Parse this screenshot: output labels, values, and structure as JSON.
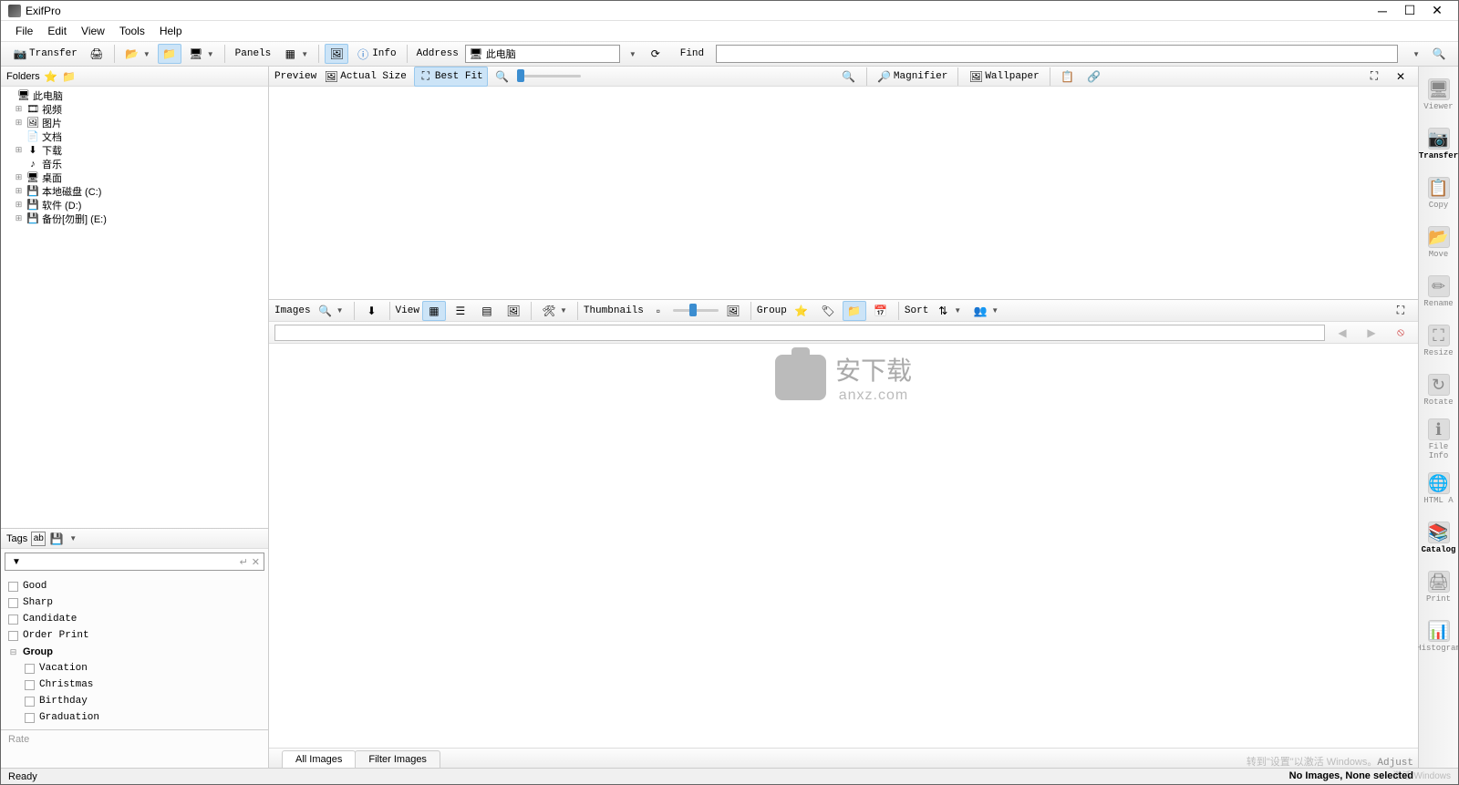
{
  "window": {
    "title": "ExifPro"
  },
  "menubar": [
    "File",
    "Edit",
    "View",
    "Tools",
    "Help"
  ],
  "toolbar": {
    "transfer": "Transfer",
    "panels": "Panels",
    "info": "Info",
    "address_label": "Address",
    "address_value": "此电脑",
    "find_label": "Find"
  },
  "folders": {
    "title": "Folders",
    "items": [
      {
        "expand": "",
        "icon": "🖥",
        "label": "此电脑",
        "level": 0
      },
      {
        "expand": "⊞",
        "icon": "🎞",
        "label": "视频",
        "level": 1
      },
      {
        "expand": "⊞",
        "icon": "🖼",
        "label": "图片",
        "level": 1
      },
      {
        "expand": "",
        "icon": "📄",
        "label": "文档",
        "level": 1
      },
      {
        "expand": "⊞",
        "icon": "⬇",
        "label": "下载",
        "level": 1
      },
      {
        "expand": "",
        "icon": "♪",
        "label": "音乐",
        "level": 1
      },
      {
        "expand": "⊞",
        "icon": "🖥",
        "label": "桌面",
        "level": 1
      },
      {
        "expand": "⊞",
        "icon": "💾",
        "label": "本地磁盘 (C:)",
        "level": 1
      },
      {
        "expand": "⊞",
        "icon": "💾",
        "label": "软件 (D:)",
        "level": 1
      },
      {
        "expand": "⊞",
        "icon": "💾",
        "label": "备份[勿删] (E:)",
        "level": 1
      }
    ]
  },
  "tags": {
    "title": "Tags",
    "items": [
      {
        "label": "Good",
        "level": 0
      },
      {
        "label": "Sharp",
        "level": 0
      },
      {
        "label": "Candidate",
        "level": 0
      },
      {
        "label": "Order Print",
        "level": 0
      },
      {
        "label": "Group",
        "level": 0,
        "bold": true,
        "group": true
      },
      {
        "label": "Vacation",
        "level": 1
      },
      {
        "label": "Christmas",
        "level": 1
      },
      {
        "label": "Birthday",
        "level": 1
      },
      {
        "label": "Graduation",
        "level": 1
      }
    ],
    "rate_label": "Rate"
  },
  "preview_bar": {
    "preview": "Preview",
    "actual": "Actual Size",
    "best_fit": "Best Fit",
    "magnifier": "Magnifier",
    "wallpaper": "Wallpaper"
  },
  "images_bar": {
    "images": "Images",
    "view": "View",
    "thumbnails": "Thumbnails",
    "group": "Group",
    "sort": "Sort"
  },
  "bottom_tabs": {
    "all": "All Images",
    "filter": "Filter Images"
  },
  "right_tools": [
    {
      "label": "Viewer"
    },
    {
      "label": "Transfer",
      "active": true
    },
    {
      "label": "Copy"
    },
    {
      "label": "Move"
    },
    {
      "label": "Rename"
    },
    {
      "label": "Resize"
    },
    {
      "label": "Rotate"
    },
    {
      "label": "File Info"
    },
    {
      "label": "HTML A"
    },
    {
      "label": "Catalog",
      "active": true
    },
    {
      "label": "Print"
    },
    {
      "label": "Histogram"
    }
  ],
  "statusbar": {
    "ready": "Ready",
    "activate1": "激活 Windows",
    "activate2": "转到\"设置\"以激活 Windows。",
    "adjust": "Adjust",
    "selection": "No Images, None selected"
  },
  "watermark": {
    "text1": "安下载",
    "text2": "anxz.com"
  }
}
